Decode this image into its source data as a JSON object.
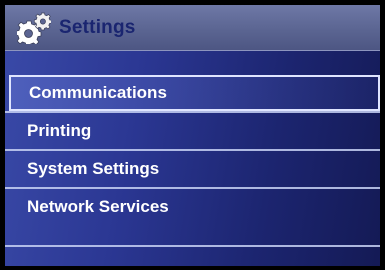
{
  "header": {
    "title": "Settings",
    "icon": "gears-icon"
  },
  "menu": {
    "items": [
      {
        "label": "Communications",
        "selected": true
      },
      {
        "label": "Printing",
        "selected": false
      },
      {
        "label": "System Settings",
        "selected": false
      },
      {
        "label": "Network Services",
        "selected": false
      }
    ]
  },
  "colors": {
    "panel_bg": "#2b3793",
    "titlebar_bg": "#5b6592",
    "title_text": "#1a2570",
    "menu_text": "#ffffff"
  }
}
